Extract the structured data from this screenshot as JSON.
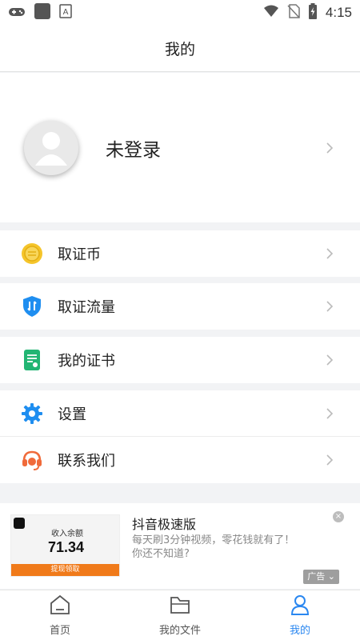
{
  "status_bar": {
    "time": "4:15",
    "icons": [
      "gamepad-icon",
      "app-square-icon",
      "keyboard-a-icon",
      "wifi-icon",
      "no-sim-icon",
      "battery-charging-icon"
    ]
  },
  "header": {
    "title": "我的"
  },
  "profile": {
    "name": "未登录",
    "avatar_icon": "user-avatar-icon"
  },
  "menu": [
    {
      "label": "取证币",
      "icon": "coin-icon",
      "color": "#f5c52b"
    },
    {
      "label": "取证流量",
      "icon": "shield-traffic-icon",
      "color": "#1f8ef0"
    },
    {
      "label": "我的证书",
      "icon": "certificate-icon",
      "color": "#22b573"
    },
    {
      "label": "设置",
      "icon": "settings-gear-icon",
      "color": "#1f8ef0"
    },
    {
      "label": "联系我们",
      "icon": "headset-icon",
      "color": "#f06a3a"
    }
  ],
  "ad": {
    "title": "抖音极速版",
    "description": "每天刷3分钟视频，零花钱就有了！你还不知道?",
    "badge": "广告",
    "thumb": {
      "caption": "收入余额",
      "amount": "71.34",
      "button": "提现领取"
    }
  },
  "bottom_nav": [
    {
      "label": "首页",
      "icon": "home-icon",
      "active": false
    },
    {
      "label": "我的文件",
      "icon": "folder-icon",
      "active": false
    },
    {
      "label": "我的",
      "icon": "user-icon",
      "active": true
    }
  ],
  "colors": {
    "accent": "#2a87f0",
    "background": "#f2f3f5"
  }
}
